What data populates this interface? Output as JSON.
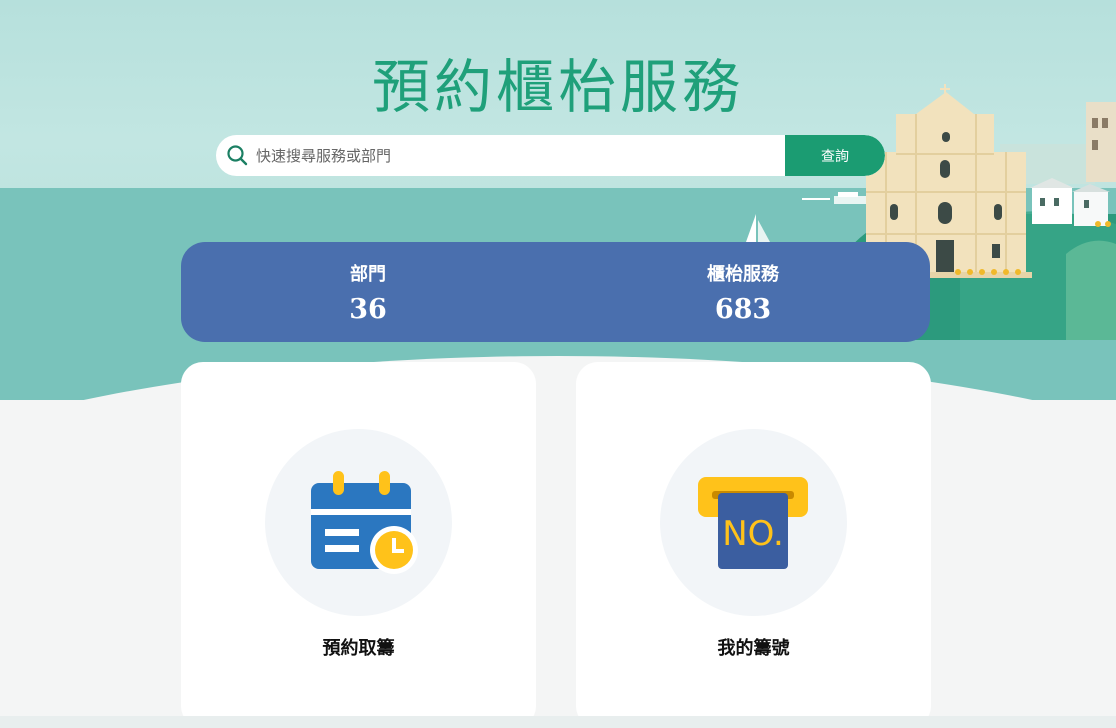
{
  "page": {
    "title": "預約櫃枱服務"
  },
  "search": {
    "placeholder": "快速搜尋服務或部門",
    "button_label": "查詢"
  },
  "stats": [
    {
      "label": "部門",
      "value": "36"
    },
    {
      "label": "櫃枱服務",
      "value": "683"
    }
  ],
  "cards": [
    {
      "label": "預約取籌",
      "icon": "calendar-clock-icon"
    },
    {
      "label": "我的籌號",
      "icon": "queue-ticket-icon",
      "icon_text": "NO."
    }
  ],
  "colors": {
    "title": "#1fa07a",
    "search_button": "#1b9c72",
    "stats_bg": "#4a6fae",
    "sea": "#79c3bb",
    "icon_blue": "#2b77c0",
    "icon_yellow": "#ffc21a",
    "ticket_blue": "#3b5ea0"
  }
}
